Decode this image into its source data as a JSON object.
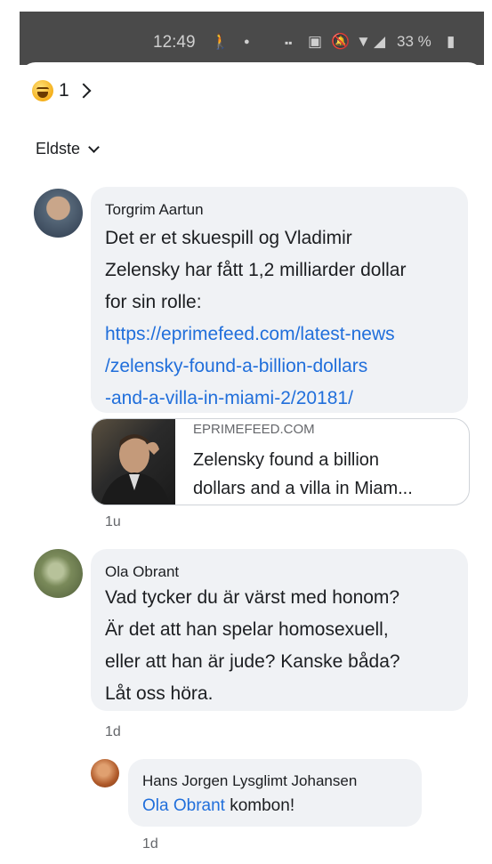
{
  "status_bar": {
    "time": "12:49",
    "battery": "33 %"
  },
  "reactions": {
    "count": "1"
  },
  "sort": {
    "label": "Eldste"
  },
  "comments": [
    {
      "author": "Torgrim Aartun",
      "lines": [
        "Det er et skuespill og Vladimir",
        "Zelensky har fått 1,2 milliarder dollar",
        "for sin rolle:"
      ],
      "link_lines": [
        "https://eprimefeed.com/latest-news",
        "/zelensky-found-a-billion-dollars",
        "-and-a-villa-in-miami-2/20181/"
      ],
      "preview": {
        "domain": "EPRIMEFEED.COM",
        "title_line1": "Zelensky found a billion",
        "title_line2": "dollars and a villa in Miam..."
      },
      "time": "1u"
    },
    {
      "author": "Ola Obrant",
      "lines": [
        "Vad tycker du är värst med honom?",
        "Är det att han spelar homosexuell,",
        "eller att han är jude? Kanske båda?",
        "Låt oss höra."
      ],
      "time": "1d"
    },
    {
      "author": "Hans Jorgen Lysglimt Johansen",
      "mention": "Ola Obrant",
      "text": "kombon!",
      "time": "1d"
    }
  ]
}
